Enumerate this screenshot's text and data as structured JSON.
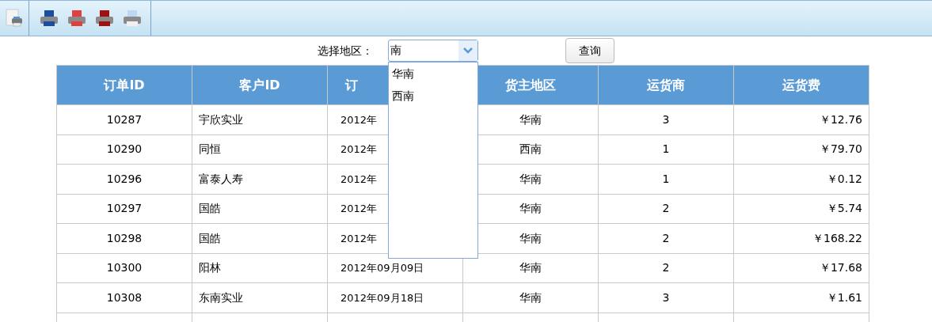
{
  "toolbar": {
    "buttons": [
      {
        "kind": "preview"
      },
      {
        "kind": "excel"
      },
      {
        "kind": "pdf"
      },
      {
        "kind": "word"
      },
      {
        "kind": "print"
      }
    ]
  },
  "filter": {
    "label": "选择地区：",
    "value": "南",
    "options": [
      "华南",
      "西南"
    ],
    "button": "查询"
  },
  "table": {
    "columns": [
      "订单ID",
      "客户ID",
      "订",
      "货主地区",
      "运货商",
      "运货费"
    ],
    "rows": [
      [
        "10287",
        "宇欣实业",
        "2012年",
        "华南",
        "3",
        "￥12.76"
      ],
      [
        "10290",
        "同恒",
        "2012年",
        "西南",
        "1",
        "￥79.70"
      ],
      [
        "10296",
        "富泰人寿",
        "2012年",
        "华南",
        "1",
        "￥0.12"
      ],
      [
        "10297",
        "国皓",
        "2012年",
        "华南",
        "2",
        "￥5.74"
      ],
      [
        "10298",
        "国皓",
        "2012年",
        "华南",
        "2",
        "￥168.22"
      ],
      [
        "10300",
        "阳林",
        "2012年09月09日",
        "华南",
        "2",
        "￥17.68"
      ],
      [
        "10308",
        "东南实业",
        "2012年09月18日",
        "华南",
        "3",
        "￥1.61"
      ]
    ]
  }
}
